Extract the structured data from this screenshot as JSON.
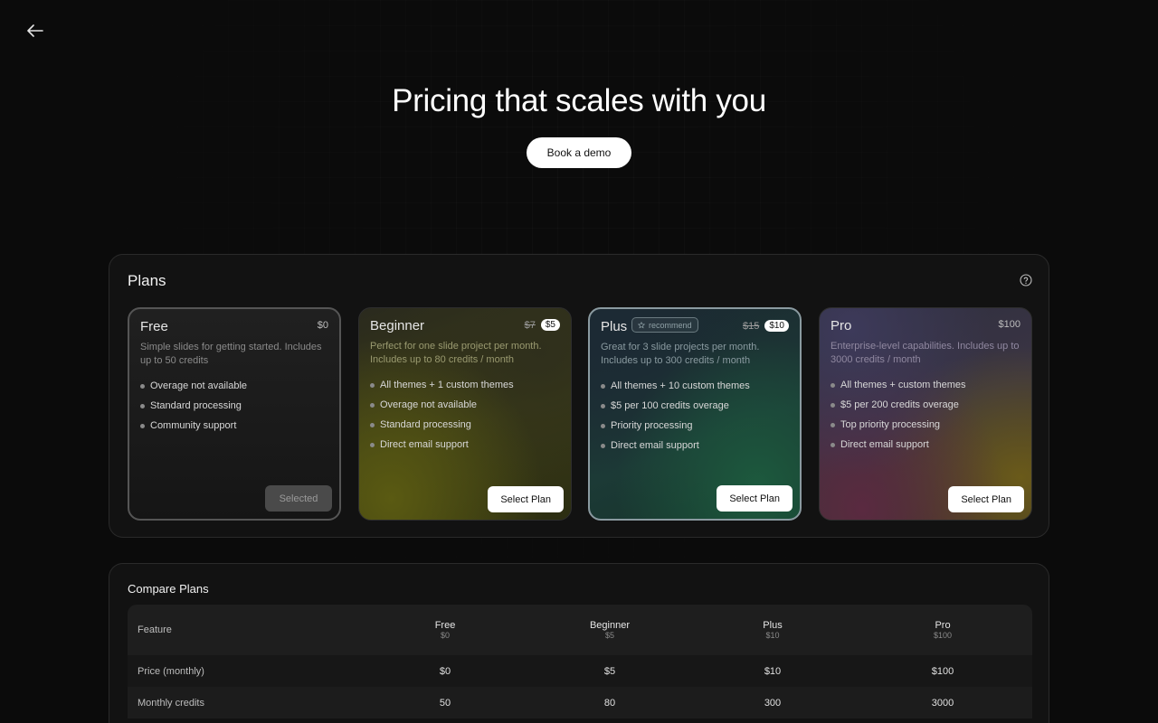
{
  "header": {
    "back_icon": "arrow-left-icon",
    "title": "Pricing that scales with you",
    "demo_button": "Book a demo"
  },
  "plans": {
    "title": "Plans",
    "help_icon": "question-circle-icon",
    "cards": [
      {
        "name": "Free",
        "price": "$0",
        "description": "Simple slides for getting started. Includes up to 50 credits",
        "features": [
          "Overage not available",
          "Standard processing",
          "Community support"
        ],
        "action": "Selected"
      },
      {
        "name": "Beginner",
        "old_price": "$7",
        "price": "$5",
        "description": "Perfect for one slide project per month. Includes up to 80 credits / month",
        "features": [
          "All themes + 1 custom themes",
          "Overage not available",
          "Standard processing",
          "Direct email support"
        ],
        "action": "Select Plan"
      },
      {
        "name": "Plus",
        "badge": "recommend",
        "old_price": "$15",
        "price": "$10",
        "description": "Great for 3 slide projects per month. Includes up to 300 credits / month",
        "features": [
          "All themes + 10 custom themes",
          "$5 per 100 credits overage",
          "Priority processing",
          "Direct email support"
        ],
        "action": "Select Plan"
      },
      {
        "name": "Pro",
        "price": "$100",
        "description": "Enterprise-level capabilities. Includes up to 3000 credits / month",
        "features": [
          "All themes + custom themes",
          "$5 per 200 credits overage",
          "Top priority processing",
          "Direct email support"
        ],
        "action": "Select Plan"
      }
    ]
  },
  "compare": {
    "title": "Compare Plans",
    "feature_header": "Feature",
    "columns": [
      {
        "name": "Free",
        "price": "$0"
      },
      {
        "name": "Beginner",
        "price": "$5"
      },
      {
        "name": "Plus",
        "price": "$10"
      },
      {
        "name": "Pro",
        "price": "$100"
      }
    ],
    "rows": [
      {
        "feature": "Price (monthly)",
        "values": [
          "$0",
          "$5",
          "$10",
          "$100"
        ]
      },
      {
        "feature": "Monthly credits",
        "values": [
          "50",
          "80",
          "300",
          "3000"
        ]
      }
    ]
  }
}
